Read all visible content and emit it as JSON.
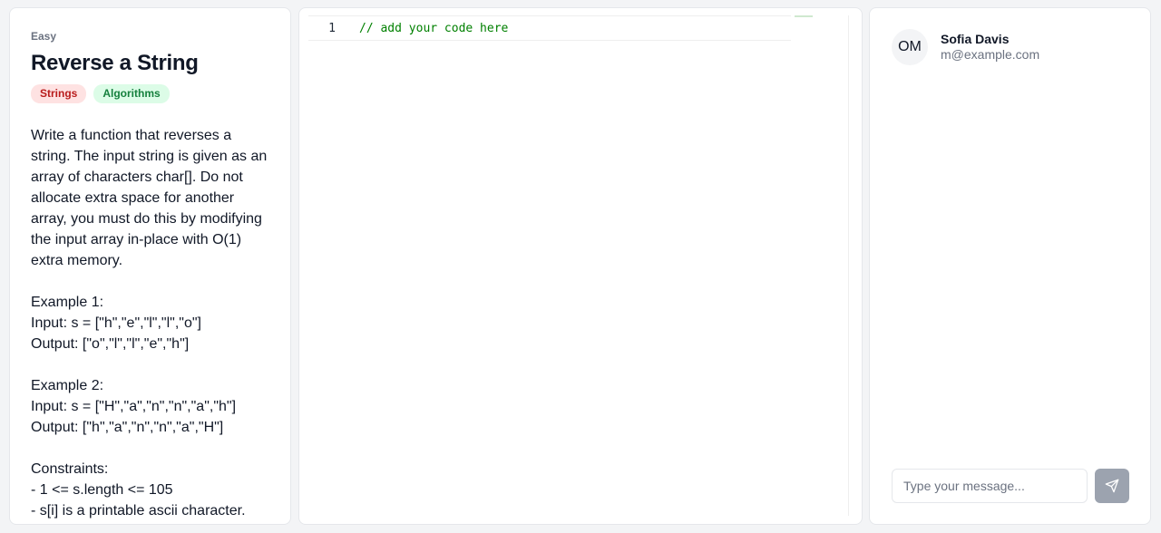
{
  "problem": {
    "difficulty": "Easy",
    "title": "Reverse a String",
    "tags": [
      "Strings",
      "Algorithms"
    ],
    "description": "Write a function that reverses a string. The input string is given as an array of characters char[]. Do not allocate extra space for another array, you must do this by modifying the input array in-place with O(1) extra memory.\n\nExample 1:\nInput: s = [\"h\",\"e\",\"l\",\"l\",\"o\"]\nOutput: [\"o\",\"l\",\"l\",\"e\",\"h\"]\n\nExample 2:\nInput: s = [\"H\",\"a\",\"n\",\"n\",\"a\",\"h\"]\nOutput: [\"h\",\"a\",\"n\",\"n\",\"a\",\"H\"]\n\nConstraints:\n- 1 <= s.length <= 105\n- s[i] is a printable ascii character."
  },
  "editor": {
    "line_number": "1",
    "code": "// add your code here"
  },
  "chat": {
    "avatar_initials": "OM",
    "user_name": "Sofia Davis",
    "user_email": "m@example.com",
    "input_placeholder": "Type your message...",
    "send_icon": "send-icon"
  }
}
